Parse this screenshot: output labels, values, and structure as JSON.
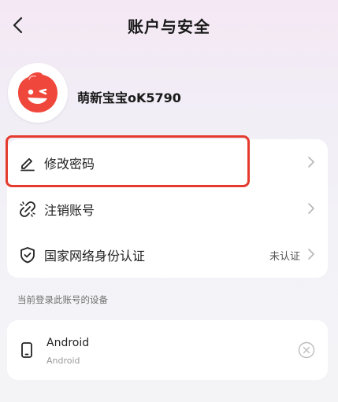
{
  "header": {
    "title": "账户与安全",
    "back_icon": "chevron-left-icon"
  },
  "profile": {
    "nickname": "萌新宝宝oK5790",
    "avatar_color": "#f0473c",
    "avatar_icon": "winking-face-avatar"
  },
  "menu": {
    "items": [
      {
        "label": "修改密码",
        "icon": "edit-pencil-icon",
        "status": "",
        "highlighted": true
      },
      {
        "label": "注销账号",
        "icon": "broken-link-icon",
        "status": ""
      },
      {
        "label": "国家网络身份认证",
        "icon": "shield-icon",
        "status": "未认证"
      }
    ]
  },
  "devices": {
    "section_label": "当前登录此账号的设备",
    "items": [
      {
        "name": "Android",
        "subtitle": "Android",
        "icon": "phone-icon",
        "action_icon": "close-circle-icon"
      }
    ]
  },
  "colors": {
    "highlight_border": "#e53a2e",
    "card_bg": "#ffffff",
    "status_text": "#555555"
  }
}
